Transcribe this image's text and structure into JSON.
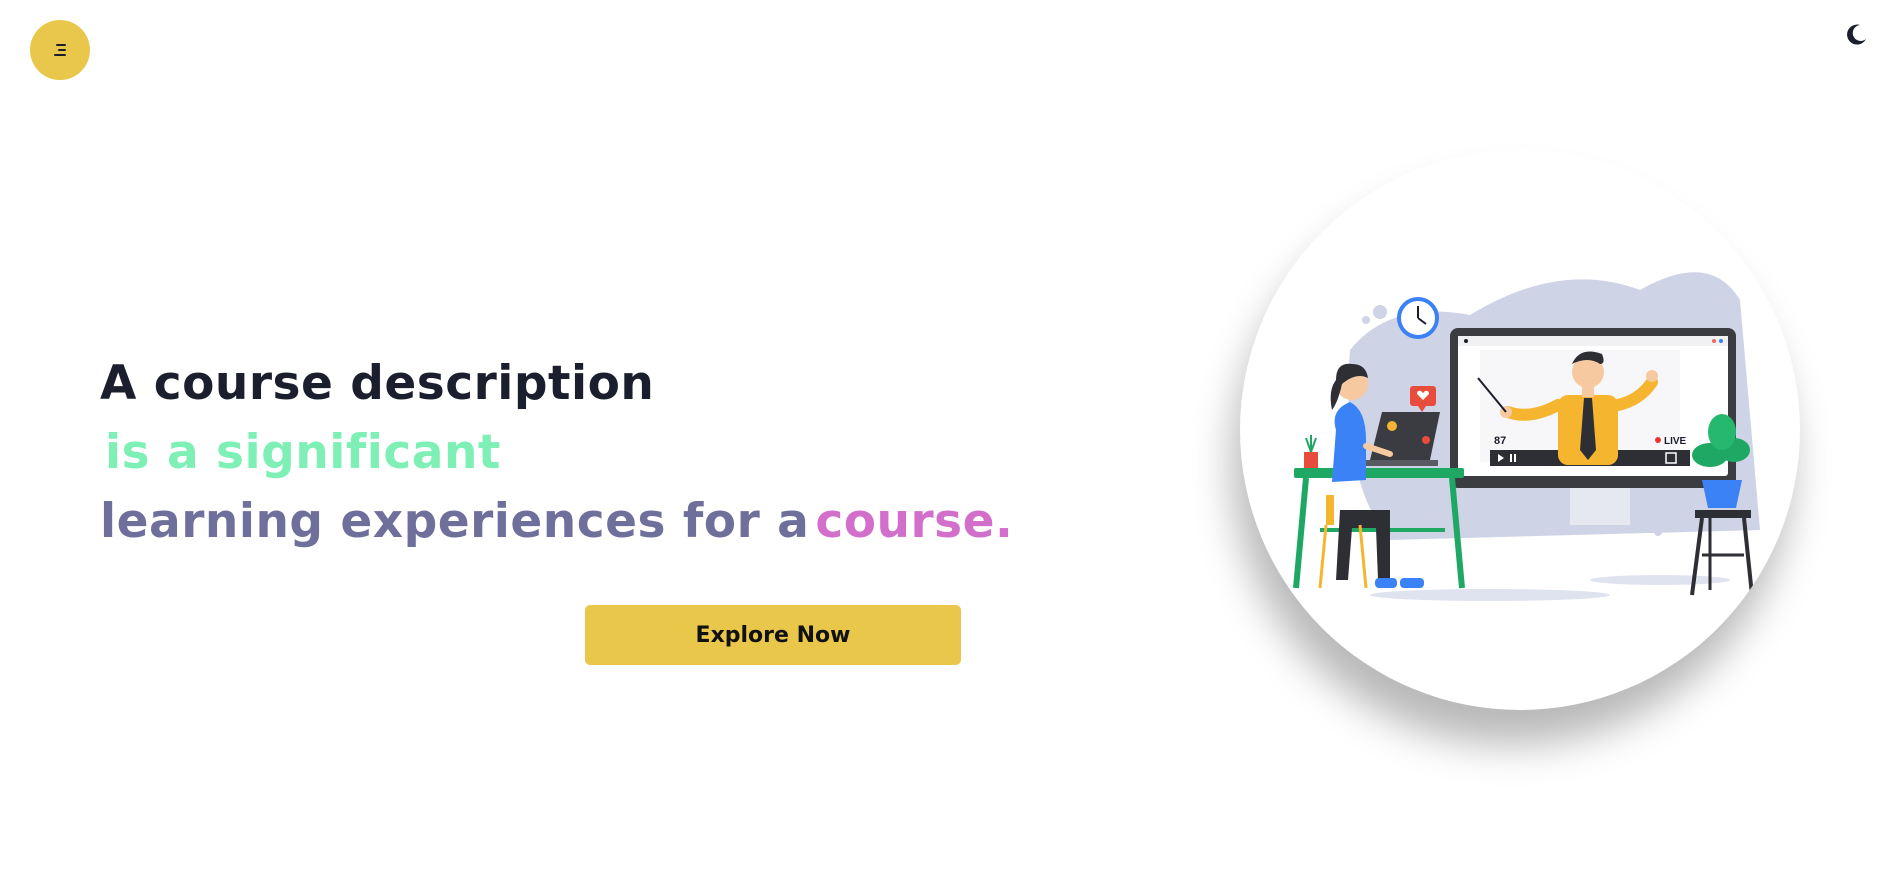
{
  "header": {
    "menu_icon": "hamburger-icon",
    "theme_toggle_icon": "moon-icon"
  },
  "hero": {
    "line1": "A course description",
    "line2": "is a significant",
    "line3_main": "learning experiences for a",
    "line3_accent": "course.",
    "cta_label": "Explore Now"
  },
  "illustration": {
    "viewer_count": "87",
    "live_label": "LIVE"
  },
  "colors": {
    "accent_yellow": "#e8c74a",
    "heading_dark": "#1b1e2c",
    "mint": "#7ef0b6",
    "slate_purple": "#6e6f9a",
    "pink": "#d16fcb"
  }
}
